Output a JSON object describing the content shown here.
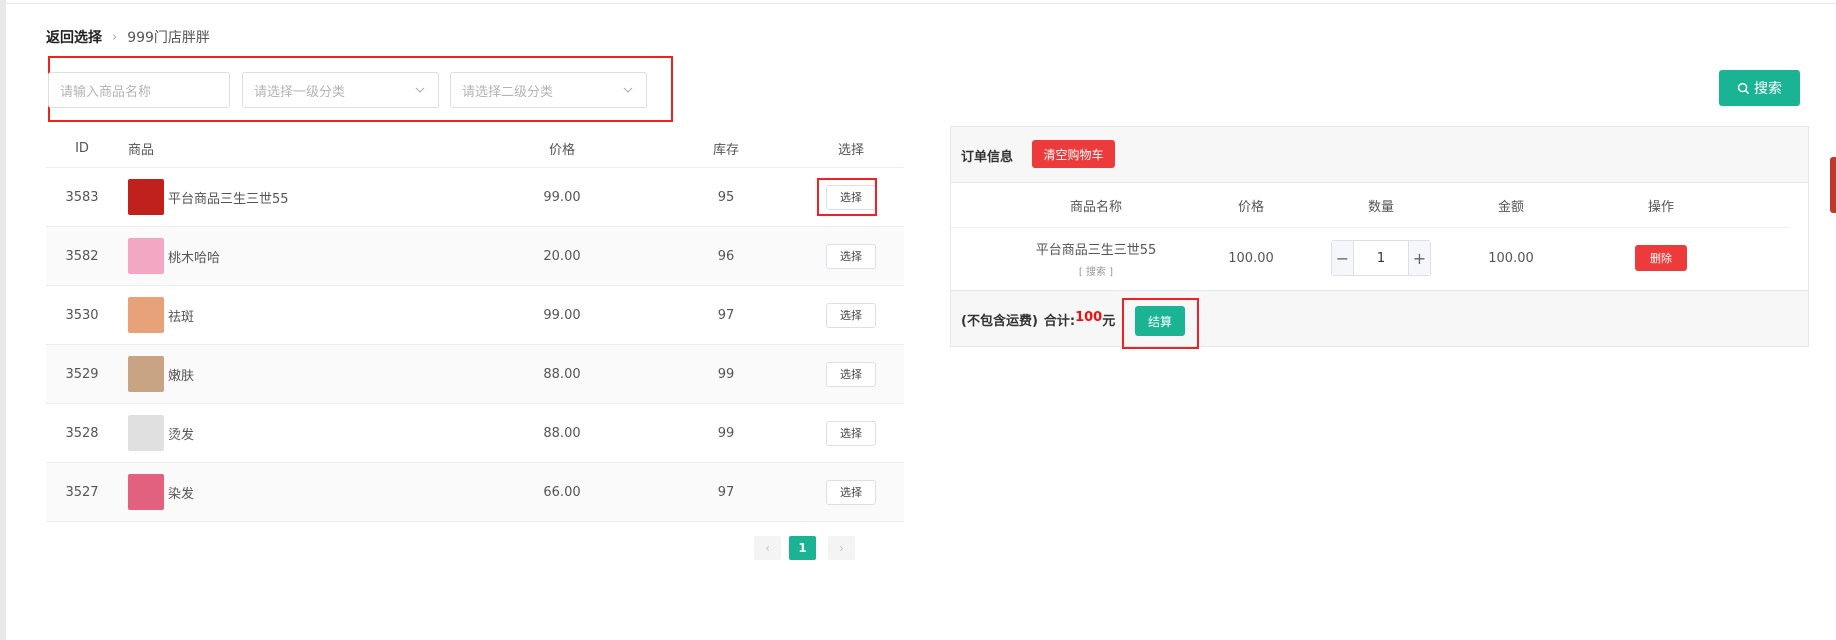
{
  "breadcrumb": {
    "back_label": "返回选择",
    "current_label": "999门店胖胖"
  },
  "filters": {
    "name_placeholder": "请输入商品名称",
    "category1_placeholder": "请选择一级分类",
    "category2_placeholder": "请选择二级分类"
  },
  "search_button": {
    "label": "搜索",
    "icon": "search-icon",
    "color": "#1ab394"
  },
  "product_table": {
    "headers": {
      "id": "ID",
      "product": "商品",
      "price": "价格",
      "stock": "库存",
      "select": "选择"
    },
    "rows": [
      {
        "id": "3583",
        "name": "平台商品三生三世55",
        "price": "99.00",
        "stock": "95",
        "select_label": "选择",
        "thumb_color": "#c0211d"
      },
      {
        "id": "3582",
        "name": "桃木哈哈",
        "price": "20.00",
        "stock": "96",
        "select_label": "选择",
        "thumb_color": "#f3a7c3"
      },
      {
        "id": "3530",
        "name": "祛斑",
        "price": "99.00",
        "stock": "97",
        "select_label": "选择",
        "thumb_color": "#e8a27a"
      },
      {
        "id": "3529",
        "name": "嫩肤",
        "price": "88.00",
        "stock": "99",
        "select_label": "选择",
        "thumb_color": "#c9a484"
      },
      {
        "id": "3528",
        "name": "烫发",
        "price": "88.00",
        "stock": "99",
        "select_label": "选择",
        "thumb_color": "#e0e0e0"
      },
      {
        "id": "3527",
        "name": "染发",
        "price": "66.00",
        "stock": "97",
        "select_label": "选择",
        "thumb_color": "#e2617e"
      }
    ]
  },
  "pagination": {
    "prev": "‹",
    "current_page": "1",
    "next": "›"
  },
  "order_panel": {
    "title": "订单信息",
    "clear_button_label": "清空购物车",
    "headers": {
      "name": "商品名称",
      "price": "价格",
      "qty": "数量",
      "amount": "金额",
      "op": "操作"
    },
    "item": {
      "name": "平台商品三生三世55",
      "tag": "[ 搜索 ]",
      "price": "100.00",
      "qty": "1",
      "qty_minus": "−",
      "qty_plus": "+",
      "amount": "100.00",
      "delete_label": "删除"
    },
    "footer": {
      "shipping_note": "(不包含运费)",
      "total_label": "合计:",
      "total_amount": "100",
      "currency": "元",
      "checkout_label": "结算"
    }
  },
  "colors": {
    "accent": "#1ab394",
    "danger": "#ed3b3b",
    "highlight": "#ee2222"
  }
}
